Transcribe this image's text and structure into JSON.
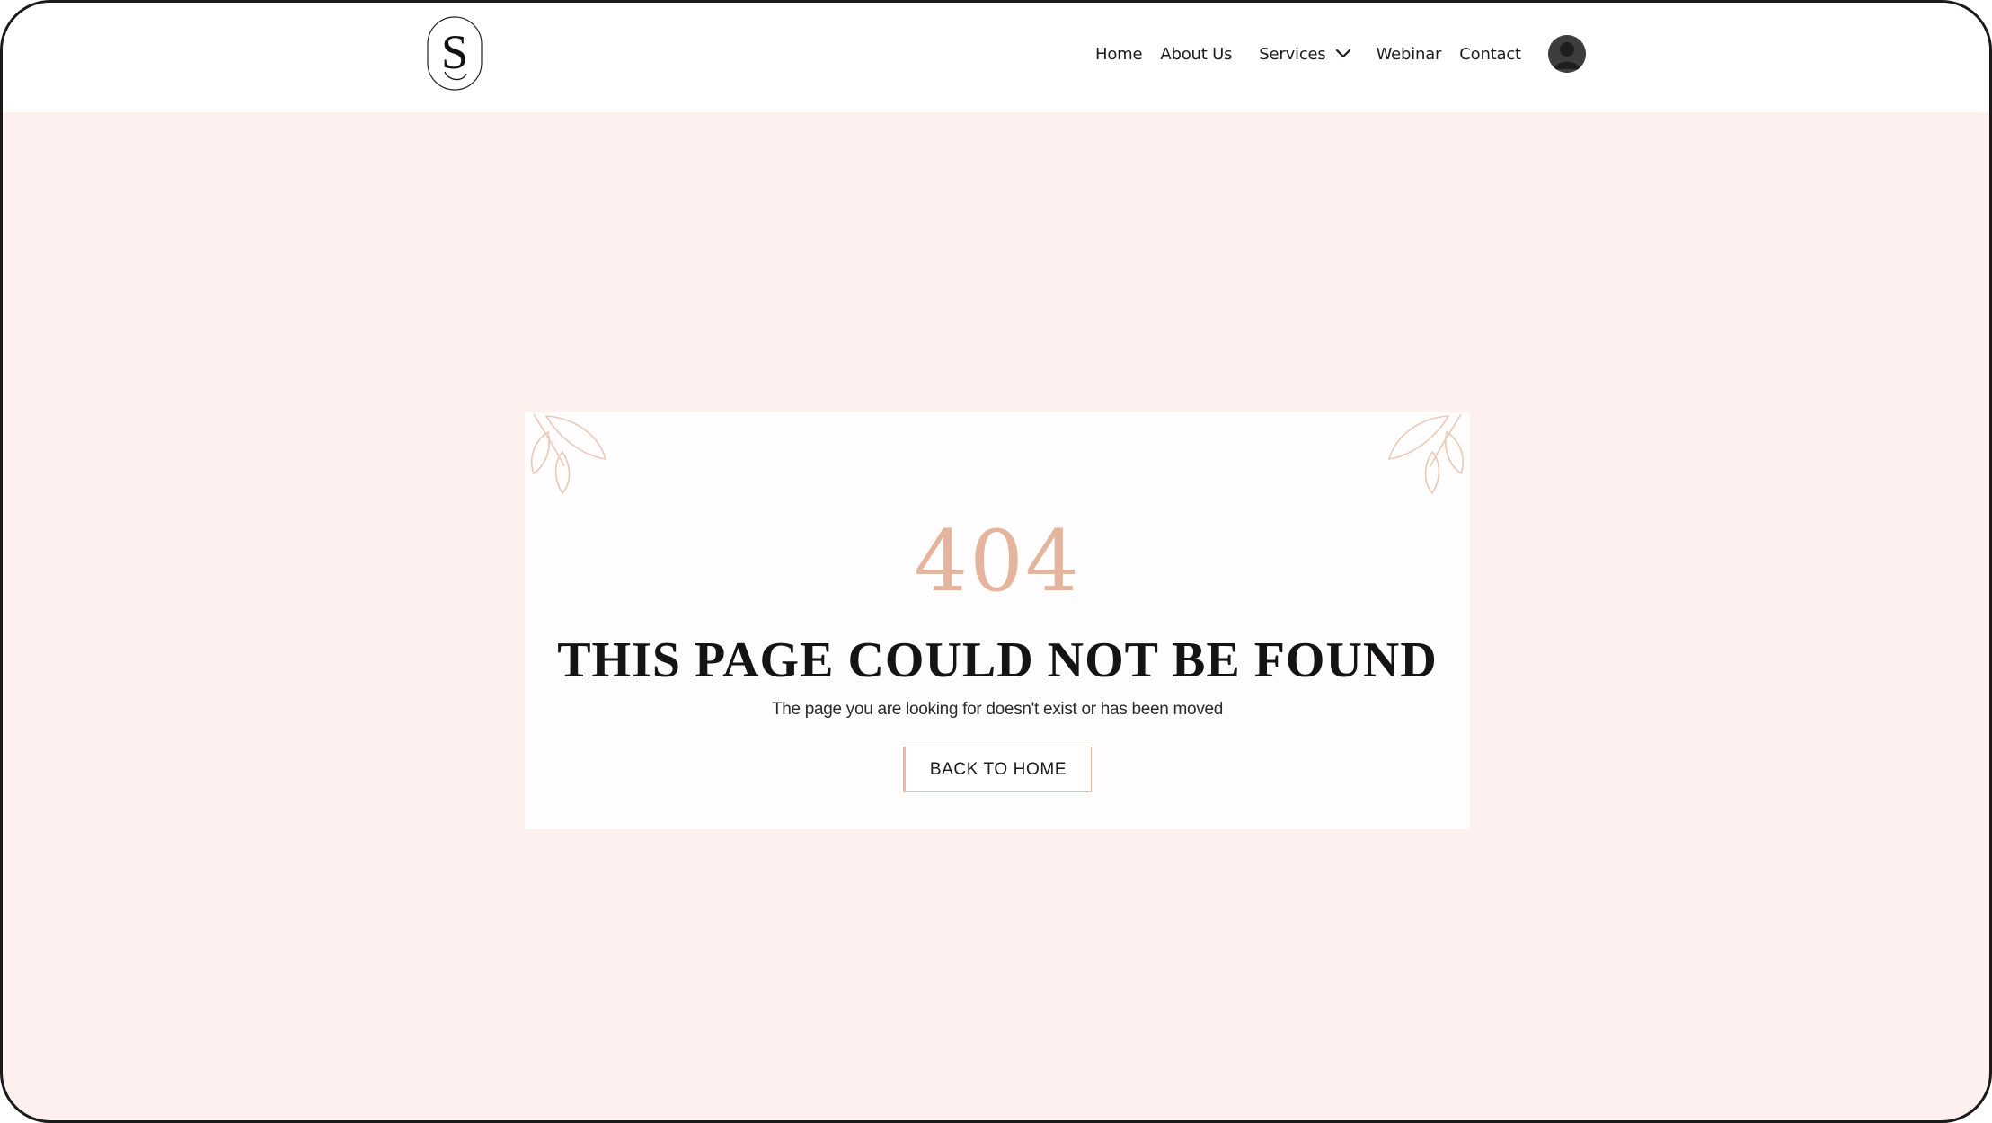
{
  "header": {
    "logo_letter": "S",
    "nav": {
      "home": "Home",
      "about": "About Us",
      "services": "Services",
      "webinar": "Webinar",
      "contact": "Contact"
    }
  },
  "error": {
    "code": "404",
    "title": "THIS PAGE COULD NOT BE FOUND",
    "subtitle": "The page you are looking for doesn't exist or has been moved",
    "back_button": "BACK TO HOME"
  },
  "colors": {
    "page_background": "#fdf0ef",
    "card_background": "#fffdfd",
    "accent": "#e4b49c",
    "text": "#141414"
  },
  "icons": {
    "logo": "s-monogram-logo",
    "services_dropdown": "chevron-down-icon",
    "account": "user-avatar-icon",
    "decoration": "leaf-branch-icon"
  }
}
